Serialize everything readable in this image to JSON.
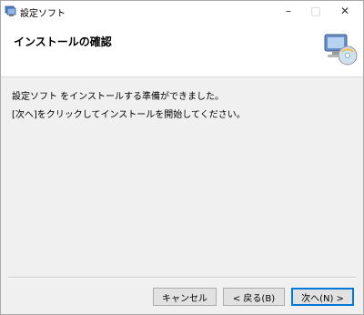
{
  "window": {
    "title": "設定ソフト",
    "controls": {
      "minimize": "–",
      "maximize": "□",
      "close": "✕"
    }
  },
  "header": {
    "title": "インストールの確認",
    "icon": "computer-cd-icon"
  },
  "body": {
    "line1": "設定ソフト をインストールする準備ができました。",
    "line2": "[次へ]をクリックしてインストールを開始してください。"
  },
  "buttons": {
    "cancel": "キャンセル",
    "back": "< 戻る(B)",
    "next": "次へ(N) >"
  },
  "colors": {
    "accent": "#0078d7",
    "panel": "#f0f0f0"
  }
}
